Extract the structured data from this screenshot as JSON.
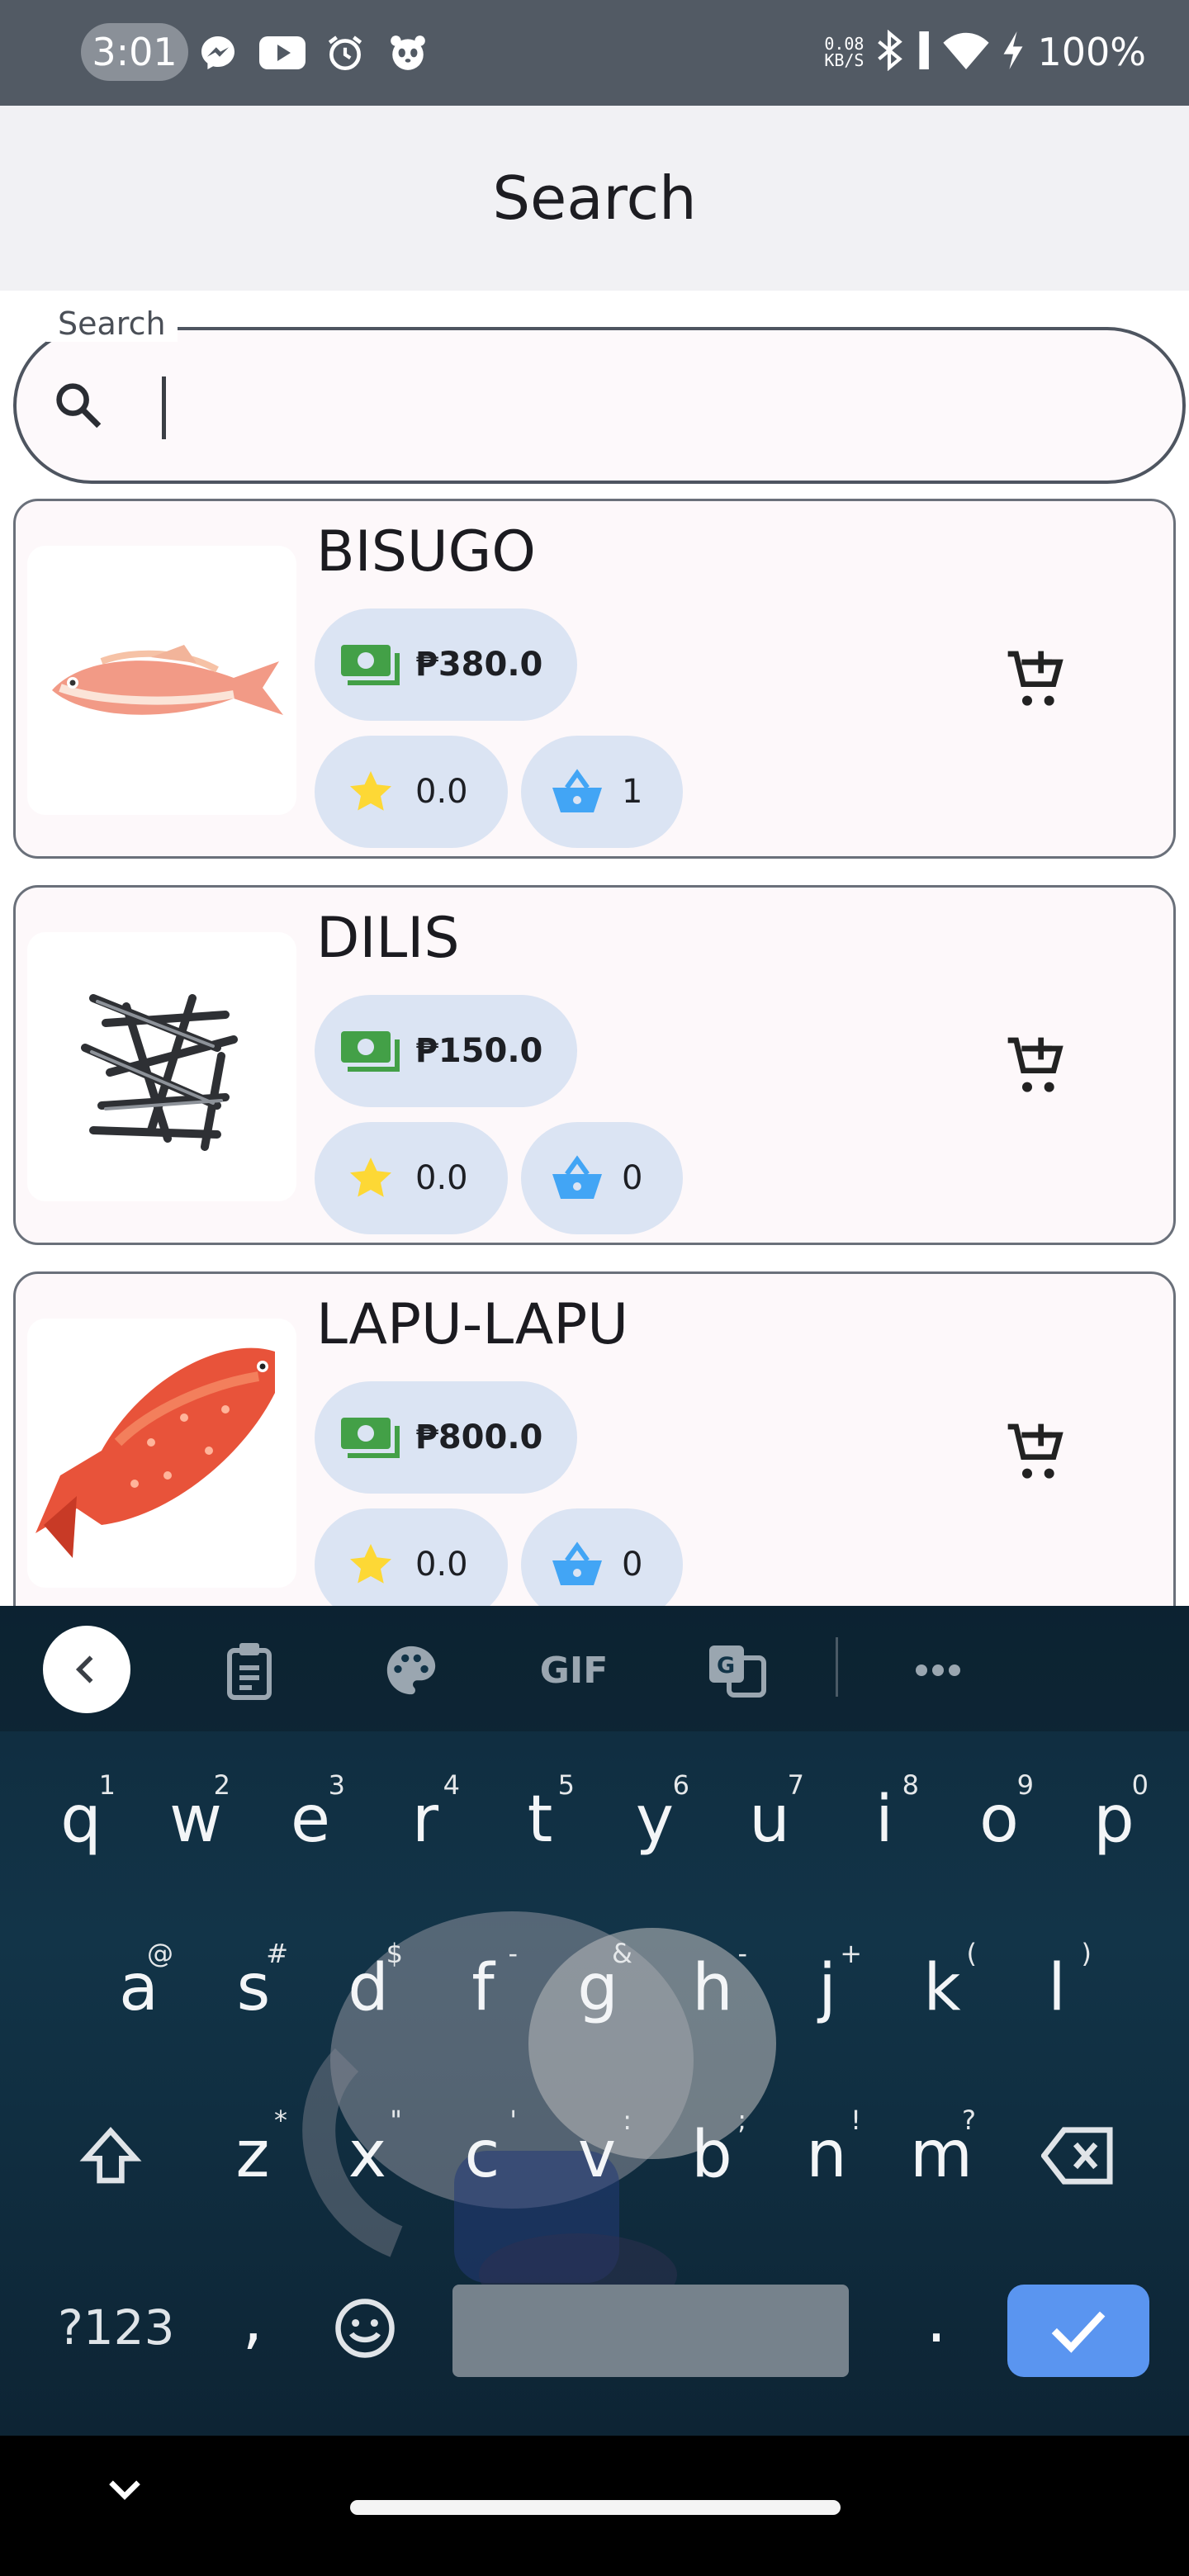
{
  "status_bar": {
    "time": "3:01",
    "net_speed_top": "0.08",
    "net_speed_bottom": "KB/S",
    "battery": "100%",
    "icons": [
      "messenger-icon",
      "youtube-icon",
      "alarm-icon",
      "panda-icon",
      "bluetooth-icon",
      "signal-icon",
      "wifi-icon",
      "charging-icon"
    ]
  },
  "app_bar": {
    "title": "Search"
  },
  "search": {
    "label": "Search",
    "value": "",
    "icon": "search-icon"
  },
  "products": [
    {
      "name": "BISUGO",
      "price": "₱380.0",
      "rating": "0.0",
      "stock": "1",
      "image": "pink-fish"
    },
    {
      "name": "DILIS",
      "price": "₱150.0",
      "rating": "0.0",
      "stock": "0",
      "image": "anchovy-pile"
    },
    {
      "name": "LAPU-LAPU",
      "price": "₱800.0",
      "rating": "0.0",
      "stock": "0",
      "image": "red-grouper"
    }
  ],
  "keyboard": {
    "toolbar": {
      "gif": "GIF"
    },
    "row1": [
      [
        "q",
        "1"
      ],
      [
        "w",
        "2"
      ],
      [
        "e",
        "3"
      ],
      [
        "r",
        "4"
      ],
      [
        "t",
        "5"
      ],
      [
        "y",
        "6"
      ],
      [
        "u",
        "7"
      ],
      [
        "i",
        "8"
      ],
      [
        "o",
        "9"
      ],
      [
        "p",
        "0"
      ]
    ],
    "row2": [
      [
        "a",
        "@"
      ],
      [
        "s",
        "#"
      ],
      [
        "d",
        "$"
      ],
      [
        "f",
        "-"
      ],
      [
        "g",
        "&"
      ],
      [
        "h",
        "-"
      ],
      [
        "j",
        "+"
      ],
      [
        "k",
        "("
      ],
      [
        "l",
        ")"
      ]
    ],
    "row3": [
      [
        "z",
        "*"
      ],
      [
        "x",
        "\""
      ],
      [
        "c",
        "'"
      ],
      [
        "v",
        ":"
      ],
      [
        "b",
        ";"
      ],
      [
        "n",
        "!"
      ],
      [
        "m",
        "?"
      ]
    ],
    "symbols_label": "?123",
    "comma": ",",
    "period": "."
  },
  "colors": {
    "status_bar": "#525a64",
    "app_bar": "#f1f1f4",
    "chip": "#dbe4f3",
    "money_green": "#43a047",
    "star_yellow": "#fdd835",
    "basket_blue": "#42a5f5",
    "enter_blue": "#5a95f0"
  }
}
